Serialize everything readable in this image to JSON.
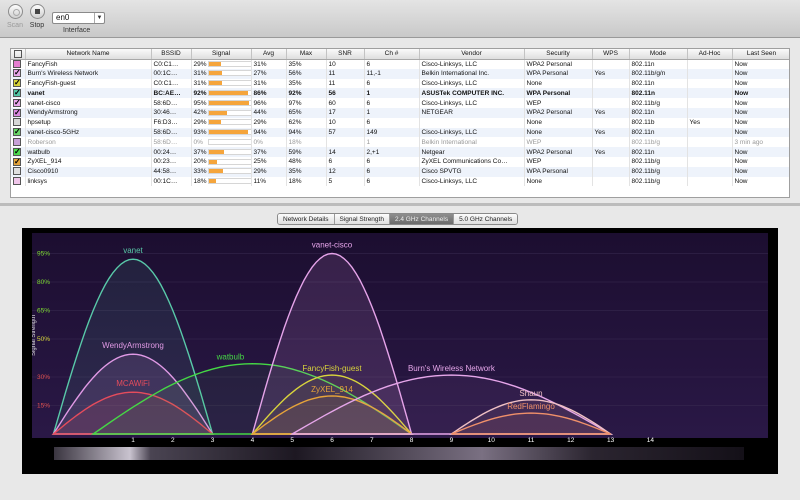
{
  "toolbar": {
    "scan_label": "Scan",
    "stop_label": "Stop",
    "interface_value": "en0",
    "interface_label": "Interface"
  },
  "table": {
    "columns": [
      "Network Name",
      "BSSID",
      "Signal",
      "Avg",
      "Max",
      "SNR",
      "Ch #",
      "Vendor",
      "Security",
      "WPS",
      "Mode",
      "Ad-Hoc",
      "Last Seen"
    ],
    "rows": [
      {
        "color": "#e57fd0",
        "checked": false,
        "name": "FancyFish",
        "bssid": "C0:C1…",
        "signal": 29,
        "signal_text": "29%",
        "avg": "31%",
        "max": "35%",
        "snr": "10",
        "ch": "6",
        "vendor": "Cisco-Linksys, LLC",
        "security": "WPA2 Personal",
        "wps": "",
        "mode": "802.11n",
        "adhoc": "",
        "last_seen": "Now"
      },
      {
        "color": "#e7a6e8",
        "checked": true,
        "name": "Burn's Wireless Network",
        "bssid": "00:1C…",
        "signal": 31,
        "signal_text": "31%",
        "avg": "27%",
        "max": "56%",
        "snr": "11",
        "ch": "11,-1",
        "vendor": "Belkin International Inc.",
        "security": "WPA Personal",
        "wps": "Yes",
        "mode": "802.11b/g/n",
        "adhoc": "",
        "last_seen": "Now"
      },
      {
        "color": "#d8d23a",
        "checked": true,
        "name": "FancyFish-guest",
        "bssid": "C0:C1…",
        "signal": 31,
        "signal_text": "31%",
        "avg": "31%",
        "max": "35%",
        "snr": "11",
        "ch": "6",
        "vendor": "Cisco-Linksys, LLC",
        "security": "None",
        "wps": "",
        "mode": "802.11n",
        "adhoc": "",
        "last_seen": "Now"
      },
      {
        "color": "#55c7a6",
        "checked": true,
        "name": "vanet",
        "bssid": "BC:AE…",
        "signal": 92,
        "signal_text": "92%",
        "avg": "86%",
        "max": "92%",
        "snr": "56",
        "ch": "1",
        "vendor": "ASUSTek COMPUTER INC.",
        "security": "WPA Personal",
        "wps": "",
        "mode": "802.11n",
        "adhoc": "",
        "last_seen": "Now",
        "bold": true
      },
      {
        "color": "#e9a6ea",
        "checked": true,
        "name": "vanet-cisco",
        "bssid": "58:6D…",
        "signal": 95,
        "signal_text": "95%",
        "avg": "96%",
        "max": "97%",
        "snr": "60",
        "ch": "6",
        "vendor": "Cisco-Linksys, LLC",
        "security": "WEP",
        "wps": "",
        "mode": "802.11b/g",
        "adhoc": "",
        "last_seen": "Now"
      },
      {
        "color": "#d98ae0",
        "checked": true,
        "name": "WendyArmstrong",
        "bssid": "30:46…",
        "signal": 42,
        "signal_text": "42%",
        "avg": "44%",
        "max": "65%",
        "snr": "17",
        "ch": "1",
        "vendor": "NETGEAR",
        "security": "WPA2 Personal",
        "wps": "Yes",
        "mode": "802.11n",
        "adhoc": "",
        "last_seen": "Now"
      },
      {
        "color": "#d7d7d7",
        "checked": false,
        "name": "hpsetup",
        "bssid": "F6:D3…",
        "signal": 29,
        "signal_text": "29%",
        "avg": "29%",
        "max": "62%",
        "snr": "10",
        "ch": "6",
        "vendor": "",
        "security": "None",
        "wps": "",
        "mode": "802.11b",
        "adhoc": "Yes",
        "last_seen": "Now"
      },
      {
        "color": "#6ad86a",
        "checked": true,
        "name": "vanet-cisco-5GHz",
        "bssid": "58:6D…",
        "signal": 93,
        "signal_text": "93%",
        "avg": "94%",
        "max": "94%",
        "snr": "57",
        "ch": "149",
        "vendor": "Cisco-Linksys, LLC",
        "security": "None",
        "wps": "Yes",
        "mode": "802.11n",
        "adhoc": "",
        "last_seen": "Now"
      },
      {
        "color": "#c7a1d8",
        "checked": false,
        "name": "Roberson",
        "bssid": "58:6D…",
        "signal": 0,
        "signal_text": "0%",
        "avg": "0%",
        "max": "18%",
        "snr": "",
        "ch": "1",
        "vendor": "Belkin International",
        "security": "WEP",
        "wps": "",
        "mode": "802.11b/g",
        "adhoc": "",
        "last_seen": "3 min ago",
        "dim": true
      },
      {
        "color": "#4ddb4d",
        "checked": true,
        "name": "watbulb",
        "bssid": "00:24…",
        "signal": 37,
        "signal_text": "37%",
        "avg": "37%",
        "max": "59%",
        "snr": "14",
        "ch": "2,+1",
        "vendor": "Netgear",
        "security": "WPA2 Personal",
        "wps": "Yes",
        "mode": "802.11n",
        "adhoc": "",
        "last_seen": "Now"
      },
      {
        "color": "#e5a43b",
        "checked": true,
        "name": "ZyXEL_914",
        "bssid": "00:23…",
        "signal": 20,
        "signal_text": "20%",
        "avg": "25%",
        "max": "48%",
        "snr": "6",
        "ch": "6",
        "vendor": "ZyXEL Communications Co…",
        "security": "WEP",
        "wps": "",
        "mode": "802.11b/g",
        "adhoc": "",
        "last_seen": "Now"
      },
      {
        "color": "#e0e0e0",
        "checked": false,
        "name": "Cisco0910",
        "bssid": "44:58…",
        "signal": 33,
        "signal_text": "33%",
        "avg": "29%",
        "max": "35%",
        "snr": "12",
        "ch": "6",
        "vendor": "Cisco SPVTG",
        "security": "WPA Personal",
        "wps": "",
        "mode": "802.11b/g",
        "adhoc": "",
        "last_seen": "Now"
      },
      {
        "color": "#f0c6ea",
        "checked": false,
        "name": "linksys",
        "bssid": "00:1C…",
        "signal": 18,
        "signal_text": "18%",
        "avg": "11%",
        "max": "18%",
        "snr": "5",
        "ch": "6",
        "vendor": "Cisco-Linksys, LLC",
        "security": "None",
        "wps": "",
        "mode": "802.11b/g",
        "adhoc": "",
        "last_seen": "Now"
      }
    ]
  },
  "tabs": [
    "Network Details",
    "Signal Strength",
    "2.4 GHz Channels",
    "5.0 GHz Channels"
  ],
  "active_tab": 2,
  "chart_data": {
    "type": "area",
    "ylabel": "Signal Strength",
    "y_ticks": [
      "95%",
      "80%",
      "65%",
      "50%",
      "30%",
      "15%"
    ],
    "y_tick_values": [
      95,
      80,
      65,
      50,
      30,
      15
    ],
    "y_tick_colors": [
      "#7cdb30",
      "#7cdb30",
      "#7cdb30",
      "#d8d83a",
      "#e05050",
      "#e05050"
    ],
    "x_ticks": [
      1,
      2,
      3,
      4,
      5,
      6,
      7,
      8,
      9,
      10,
      11,
      12,
      13,
      14
    ],
    "ylim": [
      0,
      100
    ],
    "series": [
      {
        "name": "vanet",
        "center": 1,
        "lo": -1,
        "hi": 3,
        "peak": 92,
        "color": "#59c9a9",
        "fill": "rgba(89,201,169,0.10)",
        "label_dx": 0,
        "label_dy": -6
      },
      {
        "name": "WendyArmstrong",
        "center": 1,
        "lo": -1,
        "hi": 3,
        "peak": 42,
        "color": "#e19ae6",
        "fill": "rgba(225,154,230,0.12)",
        "label_dx": 0,
        "label_dy": -6
      },
      {
        "name": "MCAWiFi",
        "center": 1,
        "lo": -1,
        "hi": 3,
        "peak": 22,
        "color": "#e54c5c",
        "fill": "rgba(229,76,92,0.12)",
        "label_dx": 0,
        "label_dy": -6
      },
      {
        "name": "watbulb",
        "center": 4,
        "lo": 0,
        "hi": 8,
        "peak": 37,
        "color": "#45d845",
        "fill": "rgba(69,216,69,0.06)",
        "label_dx": -22,
        "label_dy": -4
      },
      {
        "name": "vanet-cisco",
        "center": 6,
        "lo": 4,
        "hi": 8,
        "peak": 95,
        "color": "#e6a4ea",
        "fill": "rgba(230,164,234,0.13)",
        "label_dx": 0,
        "label_dy": -6
      },
      {
        "name": "FancyFish-guest",
        "center": 6,
        "lo": 4,
        "hi": 8,
        "peak": 31,
        "color": "#d9d43c",
        "fill": "rgba(217,212,60,0.06)",
        "label_dx": 0,
        "label_dy": -4
      },
      {
        "name": "ZyXEL_914",
        "center": 6,
        "lo": 4,
        "hi": 8,
        "peak": 20,
        "color": "#e6a33a",
        "fill": "rgba(230,163,58,0.08)",
        "label_dx": 0,
        "label_dy": -4
      },
      {
        "name": "Burn's Wireless Network",
        "center": 9,
        "lo": 5,
        "hi": 13,
        "peak": 31,
        "color": "#e6a6ea",
        "fill": "rgba(230,166,234,0.06)",
        "label_dx": 0,
        "label_dy": -4
      },
      {
        "name": "Shaun",
        "center": 11,
        "lo": 9,
        "hi": 13,
        "peak": 18,
        "color": "#efc0c4",
        "fill": "rgba(239,192,196,0.08)",
        "label_dx": 0,
        "label_dy": -4
      },
      {
        "name": "RedFlamingo",
        "center": 11,
        "lo": 9,
        "hi": 13,
        "peak": 11,
        "color": "#f0906a",
        "fill": "rgba(240,144,106,0.08)",
        "label_dx": 0,
        "label_dy": -4
      }
    ]
  }
}
